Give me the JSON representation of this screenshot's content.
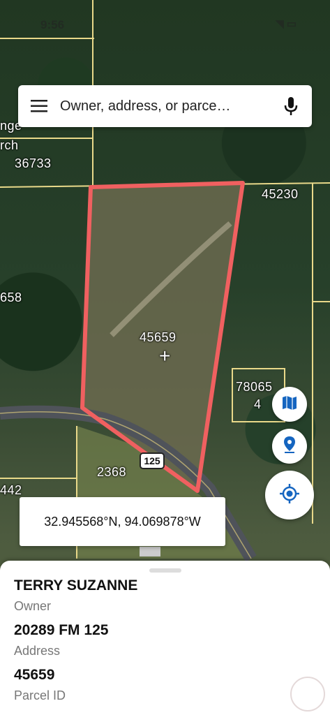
{
  "status_bar": {
    "time": "9:56",
    "icons_text": "◥ ▭"
  },
  "search": {
    "placeholder": "Owner, address, or parce…"
  },
  "map": {
    "parcel_labels": [
      "36733",
      "45230",
      "658",
      "45659",
      "78065",
      "4",
      "2368",
      "442"
    ],
    "partial_text": {
      "line1": "nge",
      "line2": "rch"
    },
    "road_shield": "125",
    "crosshair": "+"
  },
  "coordinates": "32.945568°N, 94.069878°W",
  "parcel": {
    "owner_value": "TERRY SUZANNE",
    "owner_label": "Owner",
    "address_value": "20289 FM 125",
    "address_label": "Address",
    "parcel_id_value": "45659",
    "parcel_id_label": "Parcel ID"
  },
  "colors": {
    "parcel_outline": "#f06060",
    "property_line": "#e9d98a",
    "road": "#5b5f66",
    "accent_blue": "#1565c0"
  },
  "icons": {
    "menu": "menu-icon",
    "mic": "microphone-icon",
    "layers": "map-layers-icon",
    "pin": "location-pin-icon",
    "locate": "my-location-icon"
  }
}
